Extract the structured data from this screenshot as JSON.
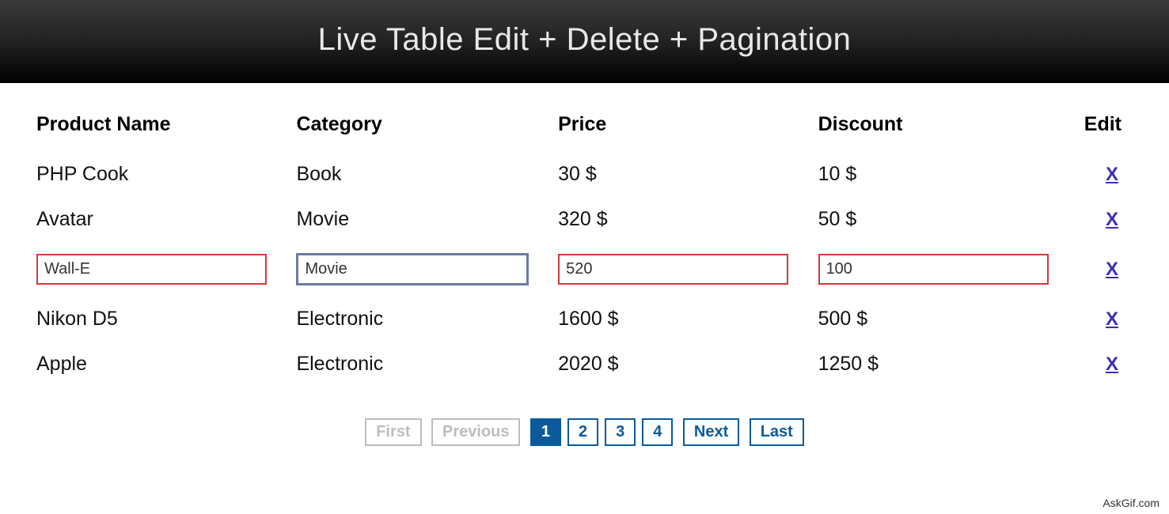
{
  "header": {
    "title": "Live Table Edit + Delete + Pagination"
  },
  "columns": {
    "name": "Product Name",
    "category": "Category",
    "price": "Price",
    "discount": "Discount",
    "edit": "Edit"
  },
  "currency_suffix": " $",
  "rows": [
    {
      "name": "PHP Cook",
      "category": "Book",
      "price": "30",
      "discount": "10",
      "editing": false
    },
    {
      "name": "Avatar",
      "category": "Movie",
      "price": "320",
      "discount": "50",
      "editing": false
    },
    {
      "name": "Wall-E",
      "category": "Movie",
      "price": "520",
      "discount": "100",
      "editing": true,
      "focused_field": "category"
    },
    {
      "name": "Nikon D5",
      "category": "Electronic",
      "price": "1600",
      "discount": "500",
      "editing": false
    },
    {
      "name": "Apple",
      "category": "Electronic",
      "price": "2020",
      "discount": "1250",
      "editing": false
    }
  ],
  "delete_label": "X",
  "pagination": {
    "first": "First",
    "previous": "Previous",
    "pages": [
      "1",
      "2",
      "3",
      "4"
    ],
    "current_page": 1,
    "next": "Next",
    "last": "Last",
    "first_disabled": true,
    "previous_disabled": true
  },
  "watermark": "AskGif.com"
}
